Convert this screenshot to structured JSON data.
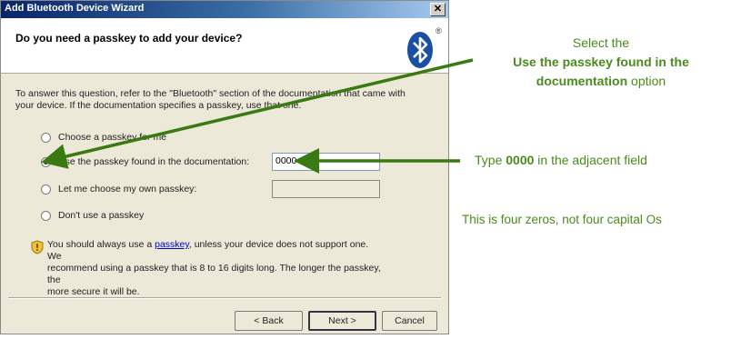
{
  "window": {
    "title": "Add Bluetooth Device Wizard",
    "close_glyph": "✕",
    "header_title": "Do you need a passkey to add your device?",
    "registered_mark": "®"
  },
  "intro": {
    "line1": "To answer this question, refer to the \"Bluetooth\" section of the documentation that came with",
    "line2": "your device. If the documentation specifies a passkey, use that one."
  },
  "options": [
    {
      "label": "Choose a passkey for me",
      "checked": false
    },
    {
      "label": "Use the passkey found in the documentation:",
      "checked": true
    },
    {
      "label": "Let me choose my own passkey:",
      "checked": false
    },
    {
      "label": "Don't use a passkey",
      "checked": false
    }
  ],
  "passkey_value": "0000",
  "warning": {
    "pre": "You should always use a ",
    "link": "passkey",
    "post1": ", unless your device does not support one. We",
    "line2": "recommend using a passkey that is 8 to 16 digits long. The longer the passkey, the",
    "line3": "more secure it will be."
  },
  "buttons": {
    "back": "< Back",
    "next": "Next >",
    "cancel": "Cancel"
  },
  "annotations": {
    "select_line1": "Select the",
    "select_line2": "Use the passkey found in the",
    "select_line3_bold": "documentation",
    "select_line3_rest": " option",
    "type_pre": "Type ",
    "type_bold": "0000",
    "type_post": " in the adjacent field",
    "note": "This is four zeros, not four capital Os"
  },
  "colors": {
    "annotation_green": "#4a8b1c",
    "bluetooth_blue": "#1b4fa3",
    "titlebar_dark": "#0a246a",
    "dialog_bg": "#ece9d8"
  },
  "icons": [
    "bluetooth-logo-icon",
    "close-icon",
    "security-shield-icon",
    "arrow-icon"
  ]
}
